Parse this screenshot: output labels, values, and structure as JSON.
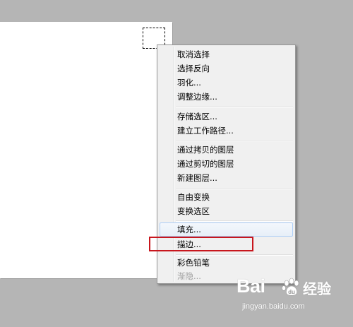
{
  "menu": {
    "items": [
      {
        "label": "取消选择",
        "disabled": false
      },
      {
        "label": "选择反向",
        "disabled": false
      },
      {
        "label": "羽化...",
        "disabled": false
      },
      {
        "label": "调整边缘...",
        "disabled": false
      },
      {
        "label": "存储选区...",
        "disabled": false
      },
      {
        "label": "建立工作路径...",
        "disabled": false
      },
      {
        "label": "通过拷贝的图层",
        "disabled": false
      },
      {
        "label": "通过剪切的图层",
        "disabled": false
      },
      {
        "label": "新建图层...",
        "disabled": false
      },
      {
        "label": "自由变换",
        "disabled": false
      },
      {
        "label": "变换选区",
        "disabled": false
      },
      {
        "label": "填充...",
        "disabled": false
      },
      {
        "label": "描边...",
        "disabled": false
      },
      {
        "label": "彩色铅笔",
        "disabled": false
      },
      {
        "label": "渐隐...",
        "disabled": true
      }
    ],
    "hovered_item": "填充...",
    "highlighted_item": "描边..."
  },
  "watermark": {
    "logo_text": "Bai",
    "jingyan_text": "经验",
    "url_text": "jingyan.baidu.com"
  },
  "colors": {
    "background": "#b5b5b5",
    "highlight_box": "#c8161d",
    "hover_border": "#aecff7"
  }
}
